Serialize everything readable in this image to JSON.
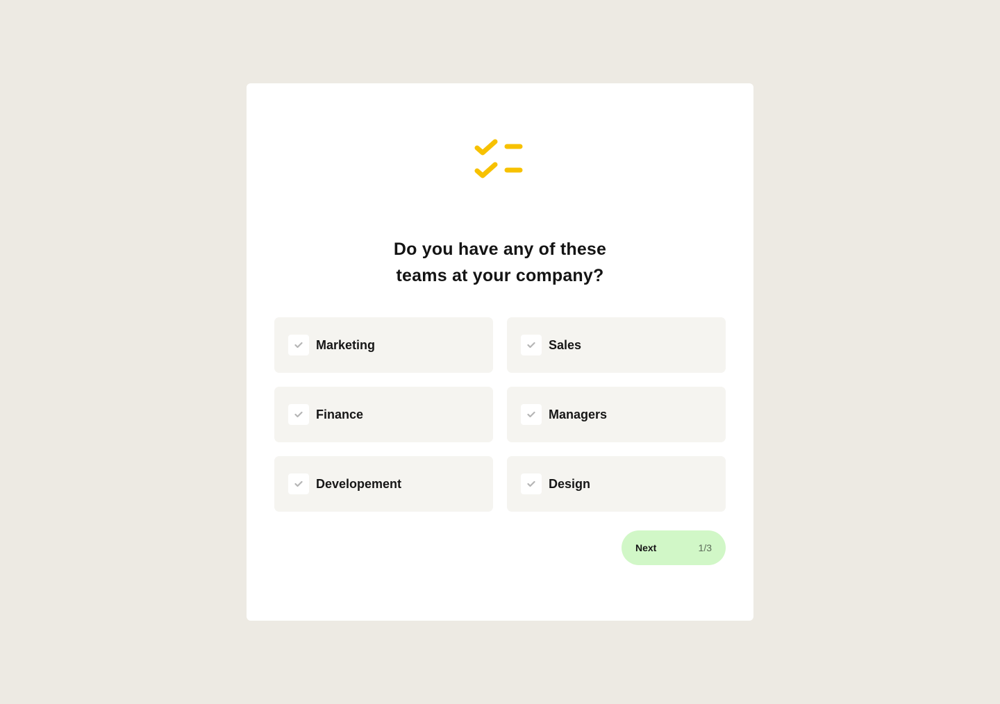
{
  "colors": {
    "background": "#edeae3",
    "card": "#ffffff",
    "accent": "#f7c100",
    "option_bg": "#f5f4f0",
    "next_button_bg": "#d1f7c7"
  },
  "header": {
    "icon": "checklist-icon"
  },
  "question": {
    "line1": "Do you have any of these",
    "line2": "teams at your company?"
  },
  "options": [
    {
      "label": "Marketing",
      "checked": false
    },
    {
      "label": "Sales",
      "checked": false
    },
    {
      "label": "Finance",
      "checked": false
    },
    {
      "label": "Managers",
      "checked": false
    },
    {
      "label": "Developement",
      "checked": false
    },
    {
      "label": "Design",
      "checked": false
    }
  ],
  "footer": {
    "next_label": "Next",
    "step": "1/3"
  }
}
